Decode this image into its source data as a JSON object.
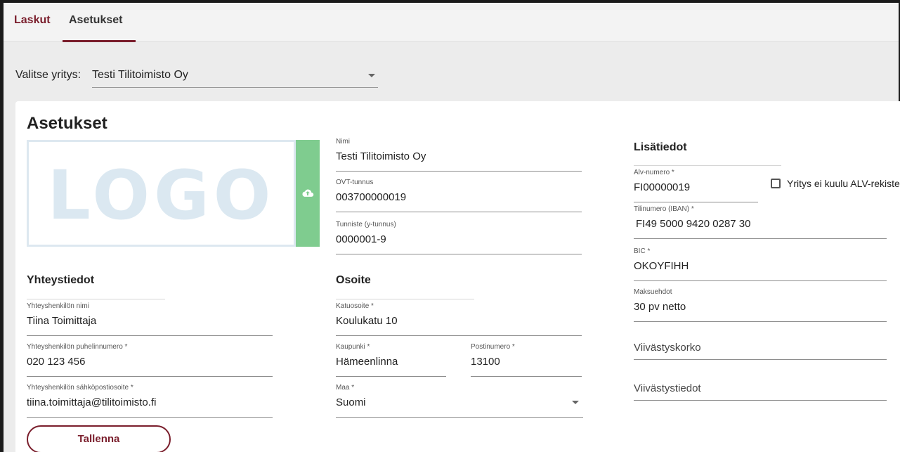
{
  "tabs": [
    {
      "label": "Laskut"
    },
    {
      "label": "Asetukset"
    }
  ],
  "company": {
    "label": "Valitse yritys:",
    "selected": "Testi Tilitoimisto Oy"
  },
  "settings": {
    "title": "Asetukset",
    "logo_text": "LOGO",
    "basic": {
      "nimi": {
        "label": "Nimi",
        "value": "Testi Tilitoimisto Oy"
      },
      "ovt": {
        "label": "OVT-tunnus",
        "value": "003700000019"
      },
      "tunniste": {
        "label": "Tunniste (y-tunnus)",
        "value": "0000001-9"
      }
    },
    "contact": {
      "title": "Yhteystiedot",
      "name": {
        "label": "Yhteyshenkilön nimi",
        "value": "Tiina Toimittaja"
      },
      "phone": {
        "label": "Yhteyshenkilön puhelinnumero *",
        "value": "020 123 456"
      },
      "email": {
        "label": "Yhteyshenkilön sähköpostiosoite *",
        "value": "tiina.toimittaja@tilitoimisto.fi"
      }
    },
    "address": {
      "title": "Osoite",
      "street": {
        "label": "Katuosoite *",
        "value": "Koulukatu 10"
      },
      "city": {
        "label": "Kaupunki *",
        "value": "Hämeenlinna"
      },
      "postal": {
        "label": "Postinumero *",
        "value": "13100"
      },
      "country": {
        "label": "Maa *",
        "value": "Suomi"
      }
    },
    "extra": {
      "title": "Lisätiedot",
      "vat": {
        "label": "Alv-numero *",
        "value": "FI00000019"
      },
      "vat_checkbox_label": "Yritys ei kuulu ALV-rekisteriin",
      "iban": {
        "label": "Tilinumero (IBAN) *",
        "value": "FI49 5000 9420 0287 30"
      },
      "bic": {
        "label": "BIC *",
        "value": "OKOYFIHH"
      },
      "terms": {
        "label": "Maksuehdot",
        "value": "30 pv netto"
      },
      "late_interest": {
        "placeholder": "Viivästyskorko"
      },
      "late_info": {
        "placeholder": "Viivästystiedot"
      }
    },
    "save_label": "Tallenna"
  },
  "colors": {
    "accent": "#7a1e2c",
    "upload": "#7fcc8f",
    "logo": "#dbe8f1"
  },
  "icons": {
    "upload": "cloud-upload-icon",
    "dropdown": "chevron-down-icon"
  }
}
